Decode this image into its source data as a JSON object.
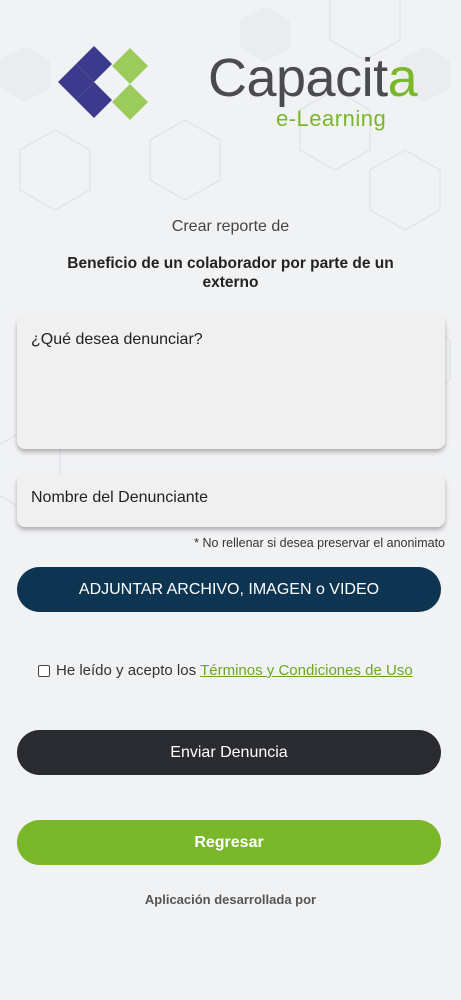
{
  "brand": {
    "name_main": "Capacit",
    "name_accent": "a",
    "tagline": "e-Learning",
    "colors": {
      "green": "#7ab72b",
      "purple": "#3d3a8e",
      "gray": "#4a4b4e"
    }
  },
  "header": {
    "subtitle": "Crear reporte de",
    "report_type": "Beneficio de un colaborador por parte de un externo"
  },
  "form": {
    "complaint": {
      "placeholder": "¿Qué desea denunciar?",
      "value": ""
    },
    "reporter_name": {
      "placeholder": "Nombre del Denunciante",
      "value": ""
    },
    "anonymity_note": "* No rellenar si desea preservar el anonimato",
    "attach_button": "ADJUNTAR ARCHIVO, IMAGEN o VIDEO",
    "terms": {
      "checked": false,
      "text": "He leído y acepto los",
      "link": "Términos y Condiciones de Uso"
    },
    "submit_button": "Enviar Denuncia",
    "back_button": "Regresar"
  },
  "footer": {
    "developed_by": "Aplicación desarrollada por"
  }
}
